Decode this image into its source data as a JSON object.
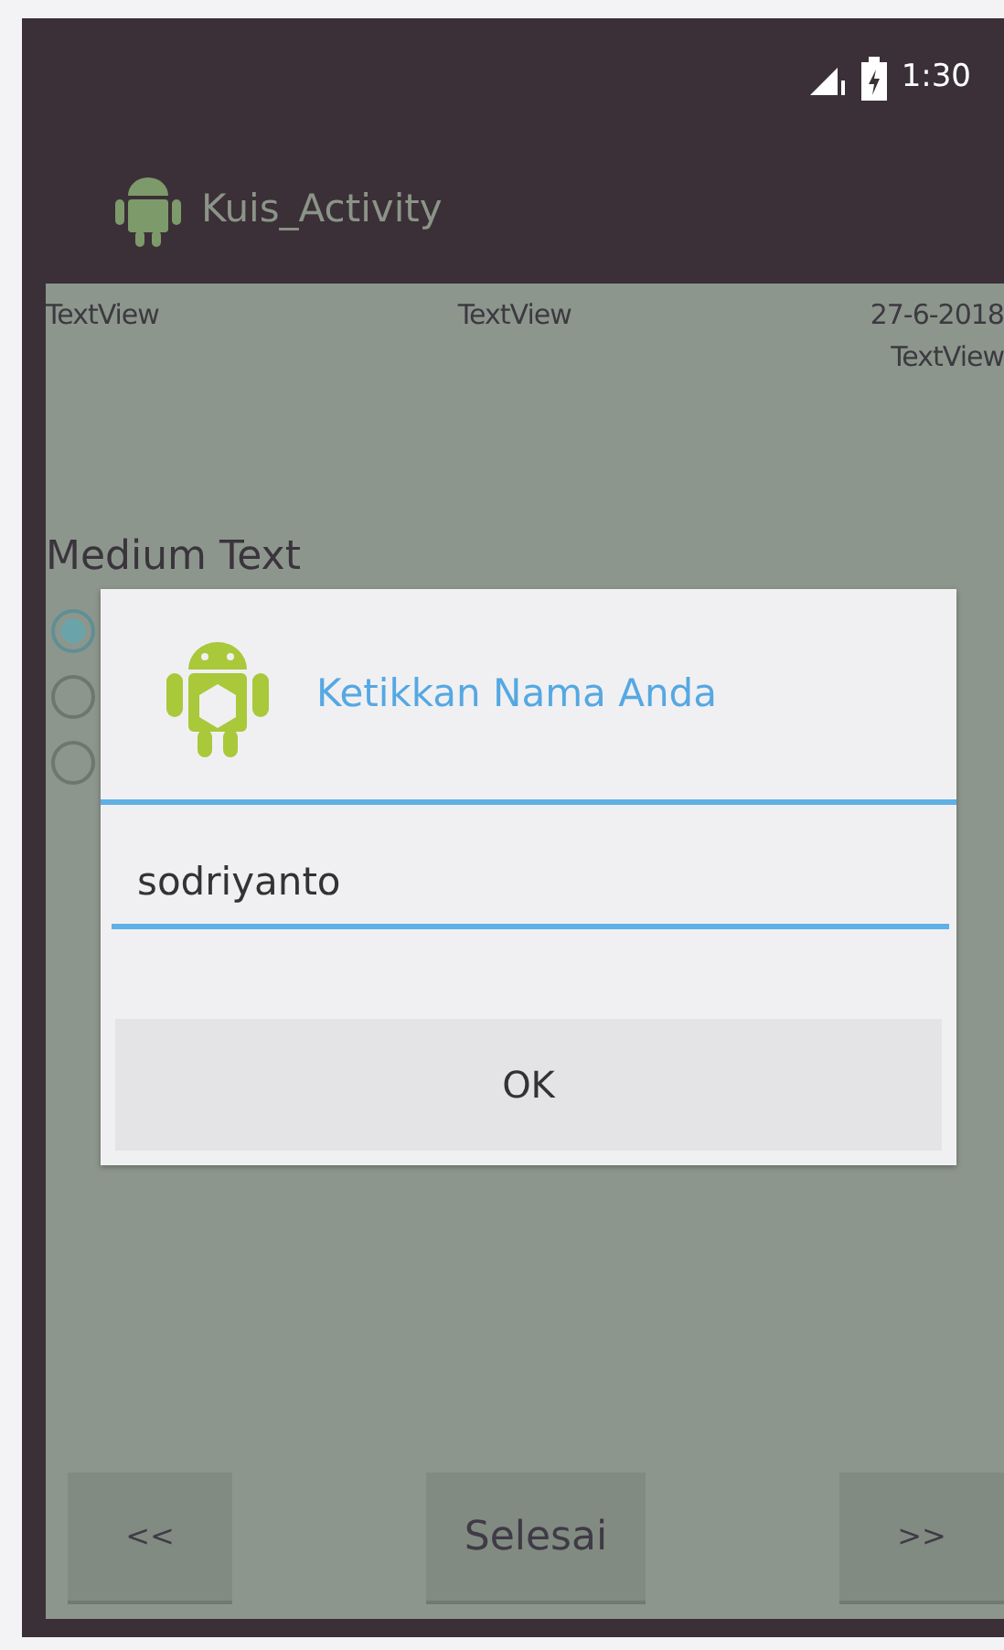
{
  "status_bar": {
    "time": "1:30"
  },
  "action_bar": {
    "title": "Kuis_Activity"
  },
  "header": {
    "left": "TextView",
    "center": "TextView",
    "date": "27-6-2018",
    "right": "TextView"
  },
  "question": "Medium Text",
  "options": [
    {
      "selected": true
    },
    {
      "selected": false
    },
    {
      "selected": false
    }
  ],
  "dialog": {
    "title": "Ketikkan Nama Anda",
    "value": "sodriyanto",
    "button": "OK"
  },
  "buttons": [
    {
      "label": "<<"
    },
    {
      "label": "Selesai"
    },
    {
      "label": ">>"
    }
  ]
}
